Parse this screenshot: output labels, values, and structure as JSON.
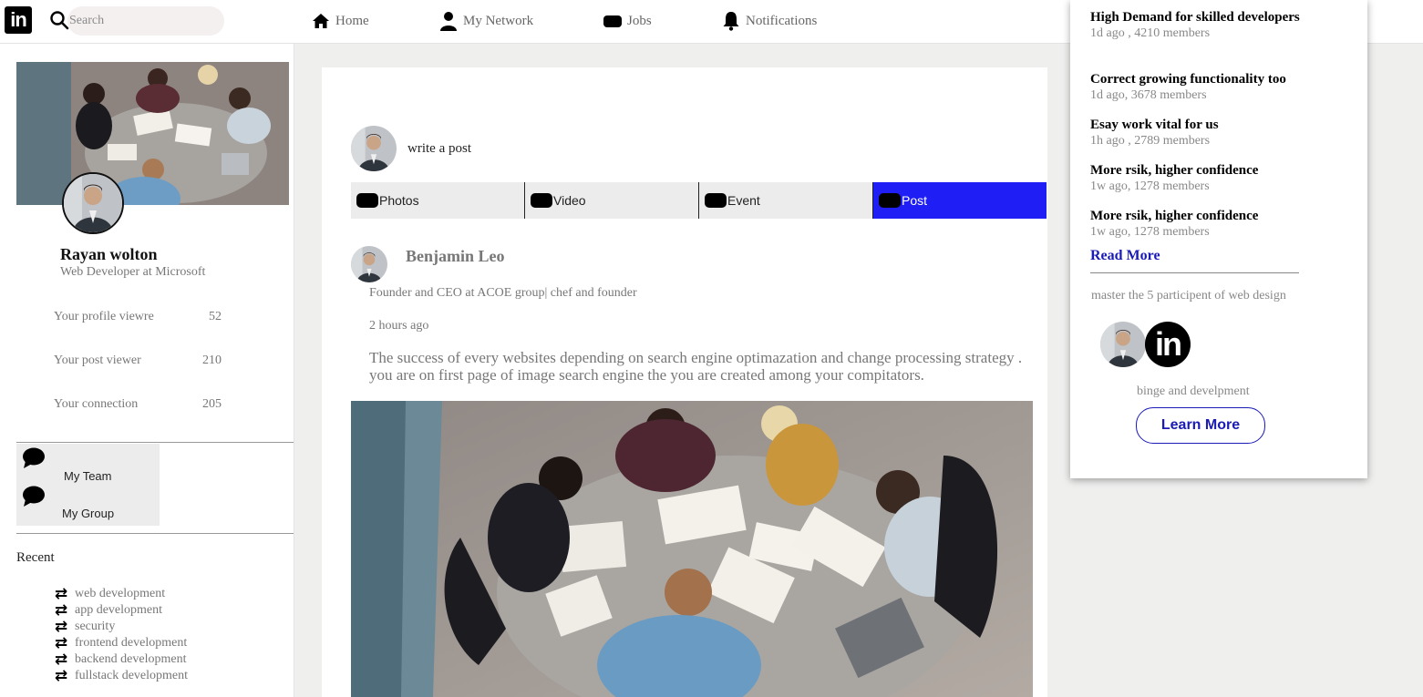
{
  "header": {
    "logo_text": "in",
    "search_placeholder": "Search",
    "nav": [
      {
        "label": "Home",
        "icon": "home-icon"
      },
      {
        "label": "My Network",
        "icon": "person-icon"
      },
      {
        "label": "Jobs",
        "icon": "briefcase-icon"
      },
      {
        "label": "Notifications",
        "icon": "bell-icon"
      }
    ]
  },
  "profile": {
    "name": "Rayan wolton",
    "title": "Web Developer at Microsoft",
    "stats": [
      {
        "label": "Your profile viewre",
        "value": "52"
      },
      {
        "label": "Your post viewer",
        "value": "210"
      },
      {
        "label": "Your connection",
        "value": "205"
      }
    ],
    "groups": [
      {
        "label": "My Team",
        "icon": "chat-bubble-icon"
      },
      {
        "label": "My Group",
        "icon": "chat-bubble-icon"
      }
    ],
    "recent_title": "Recent",
    "recent": [
      "web development",
      "app development",
      "security",
      "frontend development",
      "backend development",
      "fullstack development"
    ]
  },
  "composer": {
    "placeholder": "write a post",
    "actions": [
      {
        "label": "Photos"
      },
      {
        "label": "Video"
      },
      {
        "label": "Event"
      },
      {
        "label": "Post"
      }
    ]
  },
  "post": {
    "author": "Benjamin Leo",
    "role": "Founder and CEO at ACOE group| chef and founder",
    "time": "2 hours ago",
    "body": "The success of every websites depending on search engine optimazation and change processing strategy . you are on first page of image search engine the you are created among your compitators."
  },
  "news": {
    "items": [
      {
        "title": "High Demand for skilled developers",
        "meta": "1d ago , 4210 members"
      },
      {
        "title": "Correct growing functionality too",
        "meta": "1d ago, 3678 members"
      },
      {
        "title": "Esay work vital for us",
        "meta": "1h ago , 2789 members"
      },
      {
        "title": "More rsik, higher confidence",
        "meta": "1w ago, 1278 members"
      },
      {
        "title": "More rsik, higher confidence",
        "meta": "1w ago, 1278 members"
      }
    ],
    "read_more": "Read More"
  },
  "promo": {
    "text": "master the 5 participent of web design",
    "logo_text": "in",
    "subtitle": "binge and develpment",
    "button": "Learn More"
  },
  "colors": {
    "accent": "#1f1ff5",
    "link": "#1a1ab5",
    "muted": "#777777"
  }
}
